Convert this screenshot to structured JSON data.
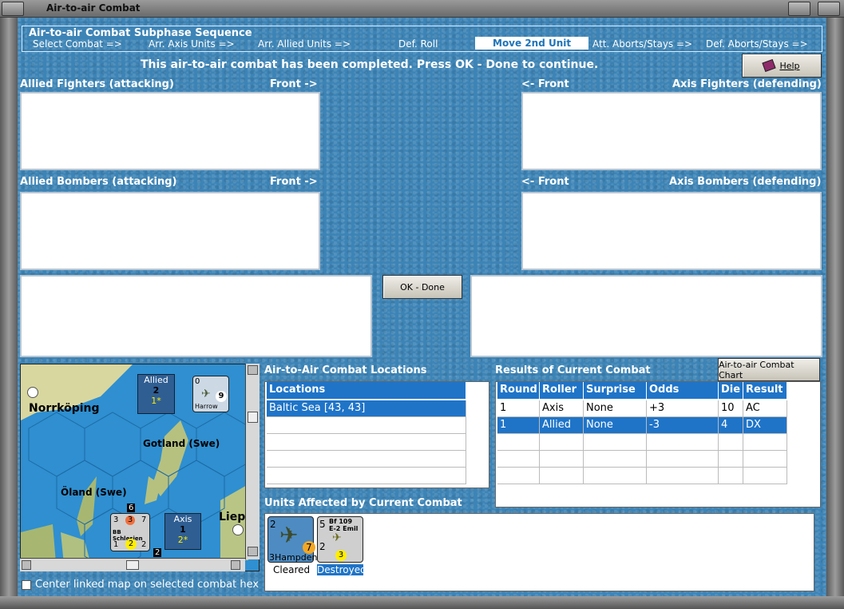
{
  "window": {
    "title": "Air-to-air Combat"
  },
  "subphase": {
    "legend": "Air-to-air Combat Subphase Sequence",
    "steps": [
      "Select Combat =>",
      "Arr. Axis Units =>",
      "Arr. Allied Units =>",
      "Def. Roll",
      "Move 2nd Unit",
      "Att. Aborts/Stays =>",
      "Def. Aborts/Stays =>"
    ],
    "active_index": 4
  },
  "message": "This air-to-air combat has been completed.  Press OK - Done to continue.",
  "help_label": "Help",
  "labels": {
    "allied_fighters": "Allied Fighters (attacking)",
    "allied_bombers": "Allied Bombers (attacking)",
    "axis_fighters": "Axis Fighters (defending)",
    "axis_bombers": "Axis Bombers (defending)",
    "front_right": "Front ->",
    "front_left": "<- Front"
  },
  "ok_label": "OK - Done",
  "map": {
    "places": [
      "Norrköping",
      "Gotland (Swe)",
      "Öland (Swe)",
      "Liep"
    ],
    "allied_box": {
      "label": "Allied",
      "value": "2",
      "sub": "1*"
    },
    "axis_box": {
      "label": "Axis",
      "value": "1",
      "sub": "2*"
    },
    "harrow": {
      "name": "Harrow",
      "top": "0",
      "right": "9",
      "bottom": "2"
    },
    "schlesien": {
      "name": "BB Schlesien",
      "tl": "3",
      "tc": "3",
      "tr": "7",
      "bl": "1",
      "bc": "2",
      "br": "2",
      "above": "6",
      "below": "2"
    }
  },
  "locations": {
    "title": "Air-to-Air Combat Locations",
    "header": "Locations",
    "rows": [
      "Baltic Sea [43, 43]",
      "",
      "",
      "",
      ""
    ]
  },
  "results": {
    "title": "Results of Current Combat",
    "chart_button": "Air-to-air Combat Chart",
    "headers": [
      "Round",
      "Roller",
      "Surprise",
      "Odds",
      "Die",
      "Result"
    ],
    "rows": [
      [
        "1",
        "Axis",
        "None",
        "+3",
        "10",
        "AC"
      ],
      [
        "1",
        "Allied",
        "None",
        "-3",
        "4",
        "DX"
      ],
      [
        "",
        "",
        "",
        "",
        "",
        ""
      ],
      [
        "",
        "",
        "",
        "",
        "",
        ""
      ],
      [
        "",
        "",
        "",
        "",
        "",
        ""
      ]
    ]
  },
  "affected": {
    "title": "Units Affected by Current Combat",
    "units": [
      {
        "name": "Hampden",
        "top": "2",
        "mid": "7",
        "bottom": "3",
        "status": "Cleared"
      },
      {
        "name": "Bf 109 E-2 Emil",
        "top": "5",
        "mid": "2",
        "bottom": "3",
        "status": "Destroyed"
      }
    ]
  },
  "center_checkbox": "Center linked map on selected combat hex"
}
